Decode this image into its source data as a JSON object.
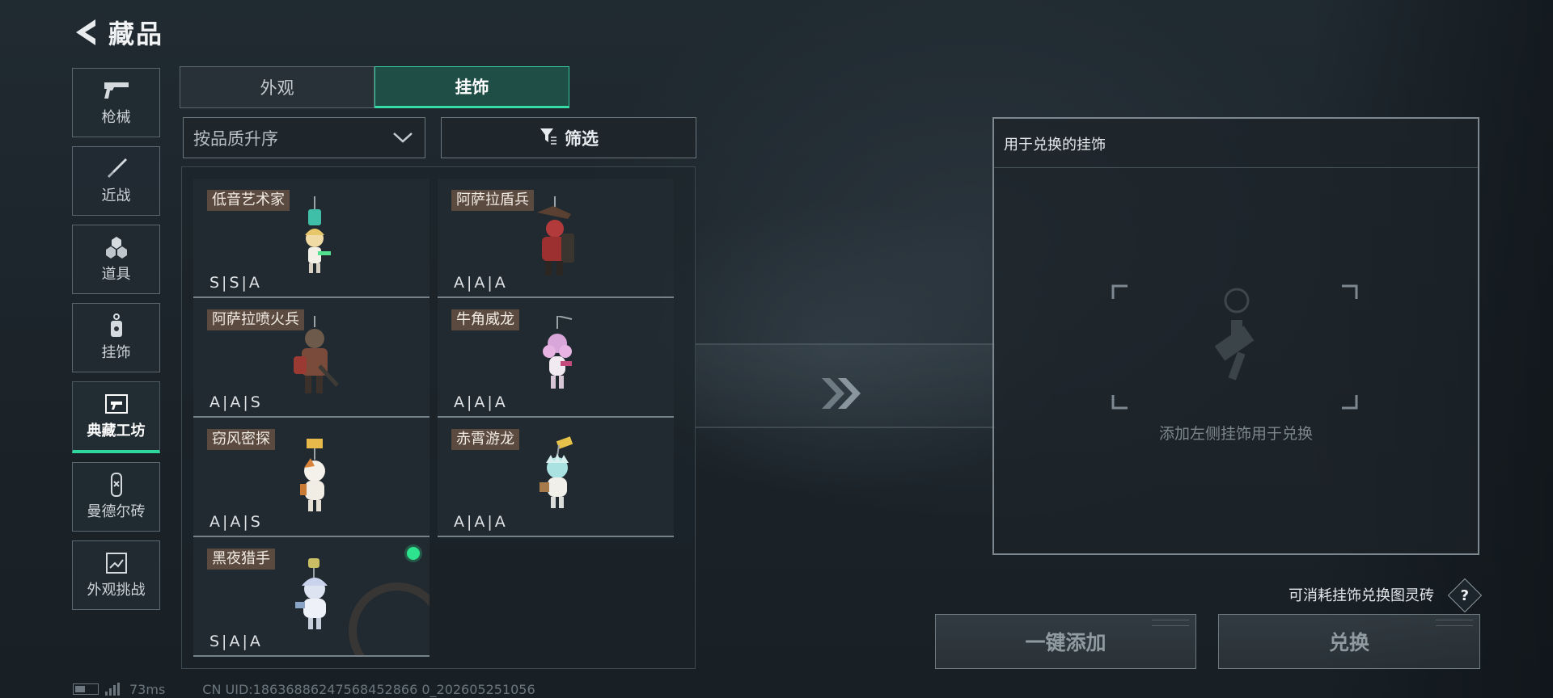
{
  "header": {
    "title": "藏品"
  },
  "categories": [
    {
      "label": "枪械",
      "icon": "gun-icon"
    },
    {
      "label": "近战",
      "icon": "knife-icon"
    },
    {
      "label": "道具",
      "icon": "grenade-icon"
    },
    {
      "label": "挂饰",
      "icon": "charm-icon"
    },
    {
      "label": "典藏工坊",
      "icon": "workshop-icon",
      "active": true
    },
    {
      "label": "曼德尔砖",
      "icon": "brick-icon"
    },
    {
      "label": "外观挑战",
      "icon": "challenge-icon"
    }
  ],
  "tabs": [
    {
      "label": "外观",
      "active": false
    },
    {
      "label": "挂饰",
      "active": true
    }
  ],
  "sort": {
    "value": "按品质升序"
  },
  "filter": {
    "label": "筛选"
  },
  "items": [
    {
      "name": "低音艺术家",
      "grades": "S|S|A"
    },
    {
      "name": "阿萨拉盾兵",
      "grades": "A|A|A"
    },
    {
      "name": "阿萨拉喷火兵",
      "grades": "A|A|S"
    },
    {
      "name": "牛角威龙",
      "grades": "A|A|A"
    },
    {
      "name": "窃风密探",
      "grades": "A|A|S"
    },
    {
      "name": "赤霄游龙",
      "grades": "A|A|A"
    },
    {
      "name": "黑夜猎手",
      "grades": "S|A|A",
      "new": true
    }
  ],
  "exchange": {
    "title": "用于兑换的挂饰",
    "hint": "添加左侧挂饰用于兑换",
    "note": "可消耗挂饰兑换图灵砖",
    "help": "?",
    "add_button": "一键添加",
    "exchange_button": "兑换"
  },
  "status": {
    "ping": "73ms",
    "uid": "CN UID:18636886247568452866 0_202605251056"
  },
  "colors": {
    "accent": "#2fd79c",
    "new_dot": "#2ee38d",
    "name_tag": "#5a4a3f"
  }
}
